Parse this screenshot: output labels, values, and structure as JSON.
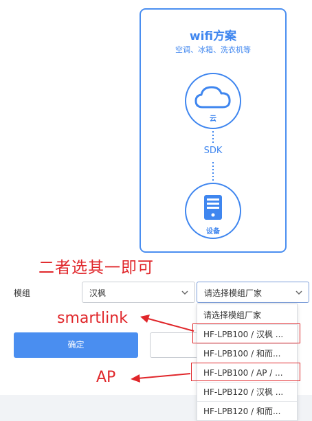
{
  "card": {
    "title": "wifi方案",
    "subtitle": "空调、冰箱、洗衣机等",
    "cloud_label": "云",
    "sdk_label": "SDK",
    "device_label": "设备"
  },
  "annotations": {
    "choose_one": "二者选其一即可",
    "smartlink": "smartlink",
    "ap": "AP"
  },
  "form": {
    "module_label": "模组",
    "vendor_select_value": "汉枫",
    "factory_select_value": "请选择模组厂家",
    "confirm_label": "确定",
    "secondary_label": ""
  },
  "dropdown": {
    "options": [
      "请选择模组厂家",
      "HF-LPB100 / 汉枫 ...",
      "HF-LPB100 / 和而...",
      "HF-LPB100 / AP / ...",
      "HF-LPB120 / 汉枫 ...",
      "HF-LPB120 / 和而..."
    ]
  },
  "colors": {
    "brand_blue": "#3f86ef",
    "button_blue": "#4a8ef0",
    "annotation_red": "#e0262a"
  },
  "icons": [
    "cloud-icon",
    "server-icon",
    "chevron-down-icon"
  ]
}
